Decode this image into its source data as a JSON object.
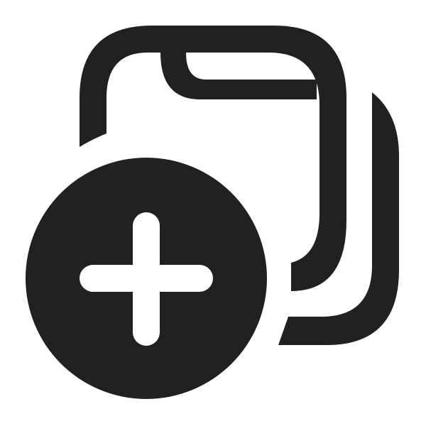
{
  "icon": {
    "name": "folders-add-icon",
    "color": "#212121",
    "background": "#ffffff",
    "glyph_color": "#ffffff"
  }
}
